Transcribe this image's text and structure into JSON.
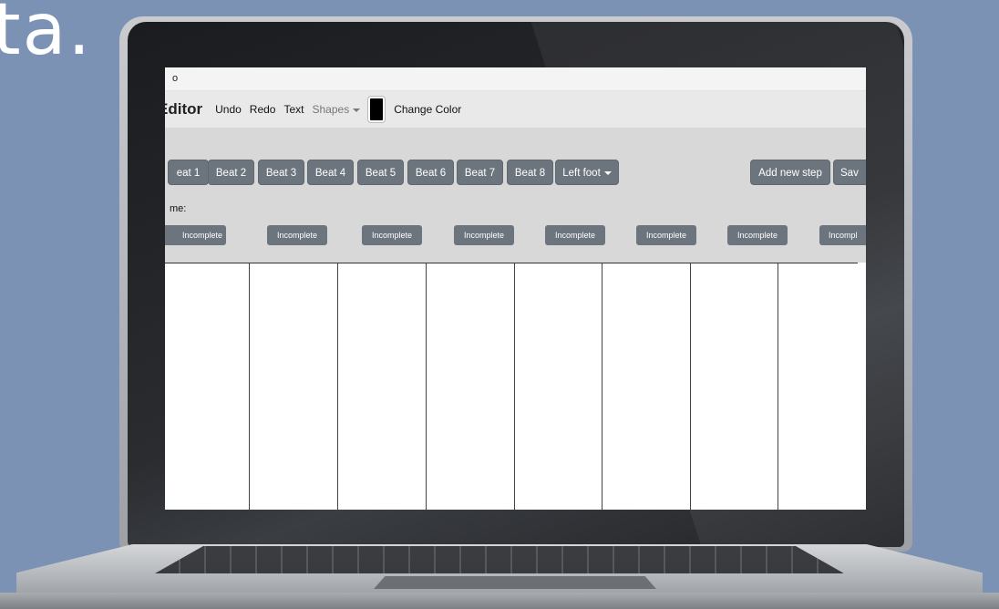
{
  "slide": {
    "text": "ta."
  },
  "window": {
    "title": "o"
  },
  "menubar": {
    "brand": "Editor",
    "undo": "Undo",
    "redo": "Redo",
    "text": "Text",
    "shapes": "Shapes",
    "change_color": "Change Color",
    "current_color": "#000000"
  },
  "beats": [
    "eat 1",
    "Beat 2",
    "Beat 3",
    "Beat 4",
    "Beat 5",
    "Beat 6",
    "Beat 7",
    "Beat 8"
  ],
  "foot_select": "Left foot",
  "add_step": "Add new step",
  "save": "Sav",
  "name_label": "me:",
  "status_items": [
    "Incomplete",
    "Incomplete",
    "Incomplete",
    "Incomplete",
    "Incomplete",
    "Incomplete",
    "Incomplete",
    "Incompl"
  ],
  "colors": {
    "background": "#7b92b4",
    "button": "#6c757d",
    "panel": "#d8d8d9"
  }
}
